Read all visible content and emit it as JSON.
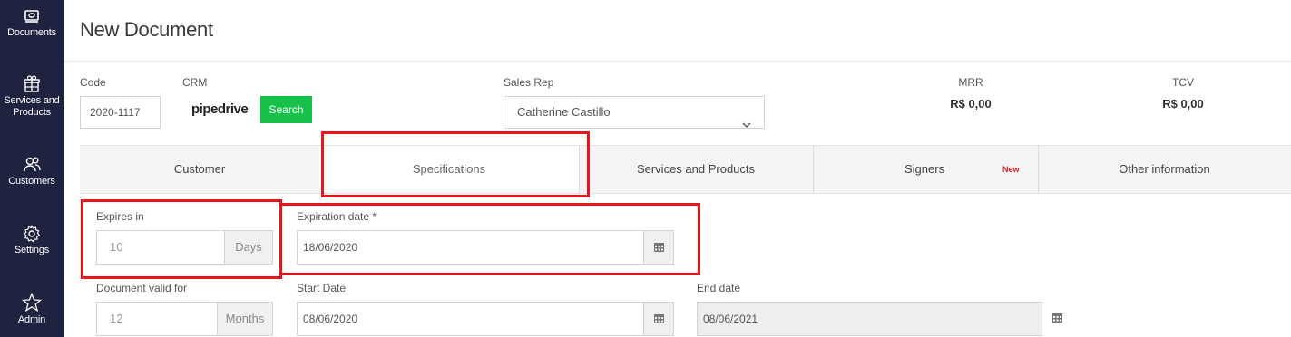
{
  "sidebar": {
    "items": [
      {
        "label": "Documents",
        "icon": "documents-icon"
      },
      {
        "label": "Services and Products",
        "icon": "gift-icon"
      },
      {
        "label": "Customers",
        "icon": "users-icon"
      },
      {
        "label": "Settings",
        "icon": "gear-icon"
      },
      {
        "label": "Admin",
        "icon": "star-icon"
      }
    ]
  },
  "page": {
    "title": "New Document"
  },
  "form": {
    "code": {
      "label": "Code",
      "value": "2020-1117"
    },
    "crm": {
      "label": "CRM",
      "brand": "pipedrive",
      "search_label": "Search"
    },
    "sales_rep": {
      "label": "Sales Rep",
      "value": "Catherine Castillo"
    },
    "mrr": {
      "label": "MRR",
      "value": "R$ 0,00"
    },
    "tcv": {
      "label": "TCV",
      "value": "R$ 0,00"
    }
  },
  "tabs": [
    {
      "label": "Customer"
    },
    {
      "label": "Specifications",
      "active": true
    },
    {
      "label": "Services and Products"
    },
    {
      "label": "Signers",
      "badge": "New"
    },
    {
      "label": "Other information"
    }
  ],
  "specs": {
    "expires_in": {
      "label": "Expires in",
      "value": "10",
      "unit": "Days"
    },
    "expiration_date": {
      "label": "Expiration date *",
      "value": "18/06/2020"
    },
    "valid_for": {
      "label": "Document valid for",
      "value": "12",
      "unit": "Months"
    },
    "start_date": {
      "label": "Start Date",
      "value": "08/06/2020"
    },
    "end_date": {
      "label": "End date",
      "value": "08/06/2021"
    }
  },
  "colors": {
    "sidebar_bg": "#1f2340",
    "search_button": "#18c14a",
    "highlight": "#e8141b",
    "new_badge": "#e02424"
  }
}
